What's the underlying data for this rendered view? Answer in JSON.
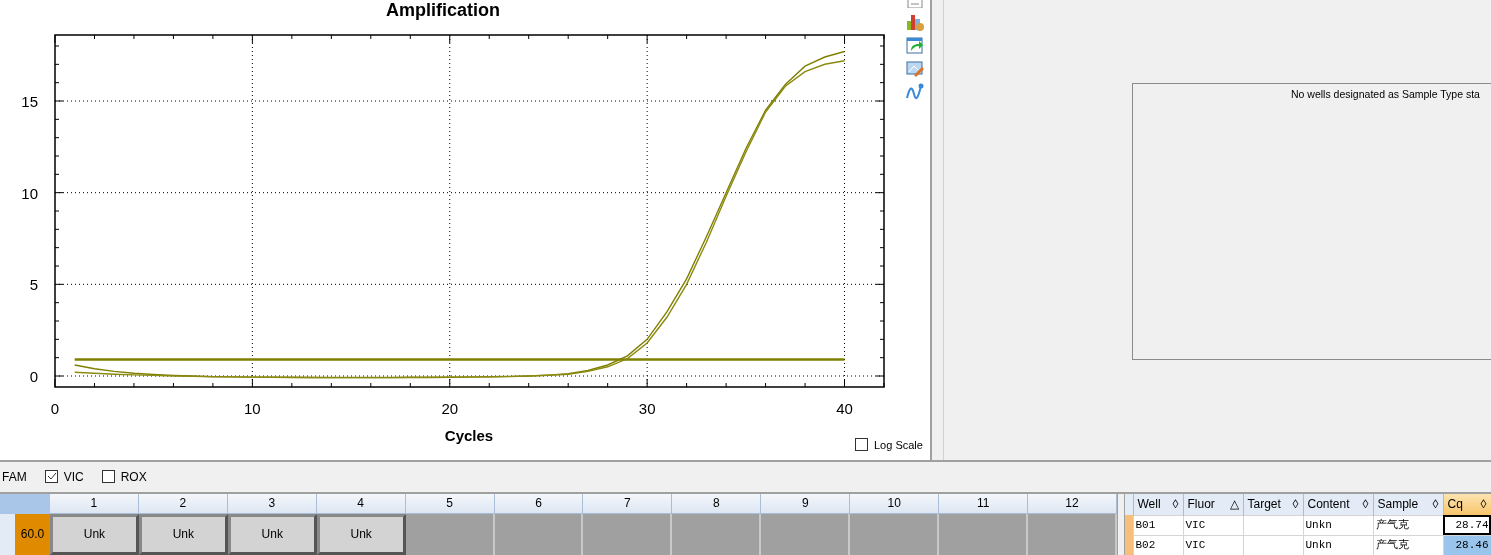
{
  "chart": {
    "log_scale": {
      "label": "Log Scale",
      "checked": false
    },
    "chart_data": {
      "type": "line",
      "title": "Amplification",
      "xlabel": "Cycles",
      "xlim": [
        0,
        42
      ],
      "ylim": [
        -0.6,
        18.6
      ],
      "grid": true,
      "xticks": [
        {
          "value": 0,
          "label": "0"
        },
        {
          "value": 10,
          "label": "10"
        },
        {
          "value": 20,
          "label": "20"
        },
        {
          "value": 30,
          "label": "30"
        },
        {
          "value": 40,
          "label": "40"
        }
      ],
      "yticks": [
        {
          "value": 0,
          "label": "0"
        },
        {
          "value": 5,
          "label": "5"
        },
        {
          "value": 10,
          "label": "10"
        },
        {
          "value": 15,
          "label": "15"
        }
      ],
      "x": [
        1,
        2,
        3,
        4,
        5,
        6,
        7,
        8,
        9,
        10,
        11,
        12,
        13,
        14,
        15,
        16,
        17,
        18,
        19,
        20,
        21,
        22,
        23,
        24,
        25,
        26,
        27,
        28,
        29,
        30,
        31,
        32,
        33,
        34,
        35,
        36,
        37,
        38,
        39,
        40
      ],
      "series": [
        {
          "color": "#7f7f00",
          "values": [
            0.9,
            0.9,
            0.9,
            0.9,
            0.9,
            0.9,
            0.9,
            0.9,
            0.9,
            0.9,
            0.9,
            0.9,
            0.9,
            0.9,
            0.9,
            0.9,
            0.9,
            0.9,
            0.9,
            0.9,
            0.9,
            0.9,
            0.9,
            0.9,
            0.9,
            0.9,
            0.9,
            0.9,
            0.9,
            0.9,
            0.9,
            0.9,
            0.9,
            0.9,
            0.9,
            0.9,
            0.9,
            0.9,
            0.9,
            0.9
          ]
        },
        {
          "color": "#808000",
          "values": [
            0.6,
            0.4,
            0.25,
            0.15,
            0.08,
            0.03,
            0,
            -0.03,
            -0.05,
            -0.06,
            -0.07,
            -0.08,
            -0.08,
            -0.09,
            -0.09,
            -0.09,
            -0.09,
            -0.08,
            -0.08,
            -0.07,
            -0.06,
            -0.05,
            -0.03,
            0,
            0.05,
            0.12,
            0.3,
            0.6,
            1.1,
            2.0,
            3.5,
            5.3,
            7.6,
            10.0,
            12.4,
            14.5,
            15.9,
            16.9,
            17.4,
            17.7
          ]
        },
        {
          "color": "#8a8a10",
          "values": [
            0.2,
            0.15,
            0.1,
            0.06,
            0.03,
            0,
            -0.02,
            -0.04,
            -0.05,
            -0.06,
            -0.07,
            -0.07,
            -0.08,
            -0.08,
            -0.08,
            -0.08,
            -0.08,
            -0.07,
            -0.07,
            -0.06,
            -0.05,
            -0.04,
            -0.02,
            0,
            0.04,
            0.1,
            0.25,
            0.5,
            0.95,
            1.8,
            3.2,
            5.0,
            7.3,
            9.8,
            12.2,
            14.4,
            15.8,
            16.6,
            17.0,
            17.2
          ]
        }
      ]
    }
  },
  "toolbar": [
    {
      "kind": "document"
    },
    {
      "kind": "chart-settings"
    },
    {
      "kind": "export"
    },
    {
      "kind": "image-edit"
    },
    {
      "kind": "curve"
    }
  ],
  "standard_curve": {
    "message": "No wells designated as Sample Type sta"
  },
  "fluors": [
    {
      "kind": "label",
      "label": "FAM"
    },
    {
      "kind": "checkbox",
      "label": "VIC",
      "checked": true
    },
    {
      "kind": "checkbox",
      "label": "ROX",
      "checked": false
    }
  ],
  "plate": {
    "columns": [
      "1",
      "2",
      "3",
      "4",
      "5",
      "6",
      "7",
      "8",
      "9",
      "10",
      "11",
      "12"
    ],
    "rows": [
      {
        "value": "60.0",
        "wells": [
          {
            "filled": true,
            "label": "Unk"
          },
          {
            "filled": true,
            "label": "Unk"
          },
          {
            "filled": true,
            "label": "Unk"
          },
          {
            "filled": true,
            "label": "Unk"
          },
          {
            "filled": false
          },
          {
            "filled": false
          },
          {
            "filled": false
          },
          {
            "filled": false
          },
          {
            "filled": false
          },
          {
            "filled": false
          },
          {
            "filled": false
          },
          {
            "filled": false
          }
        ]
      }
    ]
  },
  "well_table": {
    "columns": [
      {
        "label": "Well",
        "sort_icon": "◊",
        "selected": false
      },
      {
        "label": "Fluor",
        "sort_icon": "△",
        "selected": false
      },
      {
        "label": "Target",
        "sort_icon": "◊",
        "selected": false
      },
      {
        "label": "Content",
        "sort_icon": "◊",
        "selected": false
      },
      {
        "label": "Sample",
        "sort_icon": "◊",
        "selected": false
      },
      {
        "label": "Cq",
        "sort_icon": "◊",
        "selected": true
      }
    ],
    "rows": [
      {
        "cells": [
          "B01",
          "VIC",
          "",
          "Unkn",
          "产气克",
          "28.74"
        ],
        "focused": true,
        "selected": false
      },
      {
        "cells": [
          "B02",
          "VIC",
          "",
          "Unkn",
          "产气克",
          "28.46"
        ],
        "focused": false,
        "selected": true
      }
    ]
  }
}
